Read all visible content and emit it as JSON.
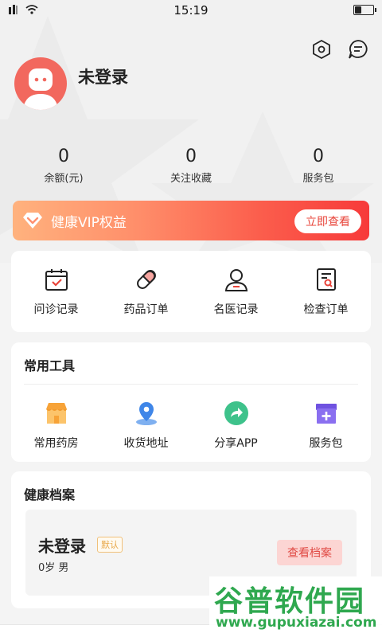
{
  "status_bar": {
    "time": "15:19"
  },
  "profile": {
    "username": "未登录"
  },
  "stats": [
    {
      "value": "0",
      "label": "余额(元)"
    },
    {
      "value": "0",
      "label": "关注收藏"
    },
    {
      "value": "0",
      "label": "服务包"
    }
  ],
  "vip": {
    "title": "健康VIP权益",
    "button": "立即查看"
  },
  "orders": [
    {
      "label": "问诊记录",
      "icon": "calendar-check-icon"
    },
    {
      "label": "药品订单",
      "icon": "pill-icon"
    },
    {
      "label": "名医记录",
      "icon": "doctor-icon"
    },
    {
      "label": "检查订单",
      "icon": "report-search-icon"
    }
  ],
  "tools": {
    "title": "常用工具",
    "items": [
      {
        "label": "常用药房",
        "icon": "pharmacy-icon"
      },
      {
        "label": "收货地址",
        "icon": "location-pin-icon"
      },
      {
        "label": "分享APP",
        "icon": "share-icon"
      },
      {
        "label": "服务包",
        "icon": "medical-kit-icon"
      }
    ]
  },
  "health": {
    "title": "健康档案",
    "name": "未登录",
    "badge": "默认",
    "info": "0岁  男",
    "button": "查看档案"
  },
  "watermark": {
    "main": "谷普软件园",
    "sub": "www.gupuxiazai.com"
  },
  "colors": {
    "accent": "#f2685e",
    "vip_start": "#ffb27e",
    "vip_end": "#f73a3a",
    "watermark": "#2fa84f"
  }
}
